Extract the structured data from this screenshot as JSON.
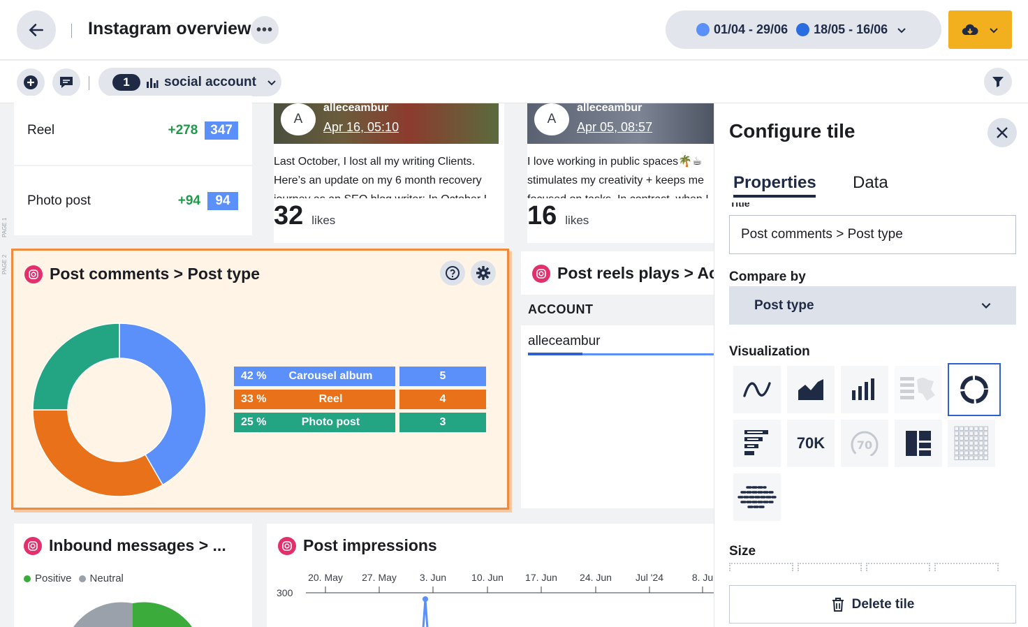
{
  "header": {
    "title": "Instagram overview",
    "more_label": "•••",
    "date_range_primary": "01/04 - 29/06",
    "date_range_compare": "18/05 - 16/06",
    "date_primary_color": "#5b8ff9",
    "date_compare_color": "#2a6de0",
    "icons": [
      "arrow-left-icon",
      "cloud-download-icon",
      "chevron-down-icon"
    ]
  },
  "toolbar": {
    "account_count": "1",
    "account_label": "social account",
    "icons": [
      "plus-icon",
      "comment-icon",
      "bar-chart-icon",
      "filter-icon"
    ]
  },
  "stats": [
    {
      "label": "Reel",
      "delta": "+278",
      "value": "347"
    },
    {
      "label": "Photo post",
      "delta": "+94",
      "value": "94"
    }
  ],
  "page_markers": {
    "page1": "PAGE 1",
    "page2": "PAGE 2"
  },
  "posts": [
    {
      "avatar": "A",
      "user": "alleceambur",
      "date": "Apr 16, 05:10",
      "text": "Last October, I lost all my writing Clients. Here’s an update on my 6 month recovery journey as an SEO blog writer: In October I",
      "likes": "32",
      "likes_label": "likes"
    },
    {
      "avatar": "A",
      "user": "alleceambur",
      "date": "Apr 05, 08:57",
      "text": "I love working in public spaces🌴☕ stimulates my creativity + keeps me focused on tasks. In contrast, when I",
      "likes": "16",
      "likes_label": "likes"
    }
  ],
  "comments_tile": {
    "title": "Post comments > Post type",
    "icons": [
      "help-icon",
      "gear-icon"
    ],
    "chart_data": {
      "type": "pie",
      "categories": [
        "Carousel album",
        "Reel",
        "Photo post"
      ],
      "values": [
        5,
        4,
        3
      ],
      "percent_labels": [
        "42 %",
        "33 %",
        "25 %"
      ],
      "colors": [
        "#5b8ff9",
        "#e8711a",
        "#23a584"
      ],
      "donut": true
    }
  },
  "reels_tile": {
    "title": "Post reels plays > Ac",
    "column_header": "ACCOUNT",
    "row_value": "alleceambur"
  },
  "inbound_tile": {
    "title": "Inbound messages > ...",
    "legend": [
      {
        "name": "Positive",
        "color": "#3bab3b"
      },
      {
        "name": "Neutral",
        "color": "#9aa1ab"
      }
    ]
  },
  "impressions_tile": {
    "title": "Post impressions",
    "x_ticks": [
      "20. May",
      "27. May",
      "3. Jun",
      "10. Jun",
      "17. Jun",
      "24. Jun",
      "Jul '24",
      "8. Ju"
    ],
    "y_tick": "300",
    "line_color": "#5b8ff9"
  },
  "config_panel": {
    "title": "Configure tile",
    "tabs": [
      "Properties",
      "Data"
    ],
    "cut_label": "Title",
    "title_value": "Post comments > Post type",
    "compare_by_label": "Compare by",
    "compare_by_value": "Post type",
    "visualization_label": "Visualization",
    "viz_options": [
      "line-chart-icon",
      "area-chart-icon",
      "bar-chart-icon",
      "map-icon",
      "donut-chart-icon",
      "horizontal-bar-icon",
      "70K",
      "70",
      "treemap-icon",
      "heatmap-icon",
      "word-cloud-icon"
    ],
    "selected_viz": "donut-chart-icon",
    "size_label": "Size",
    "delete_label": "Delete tile"
  }
}
